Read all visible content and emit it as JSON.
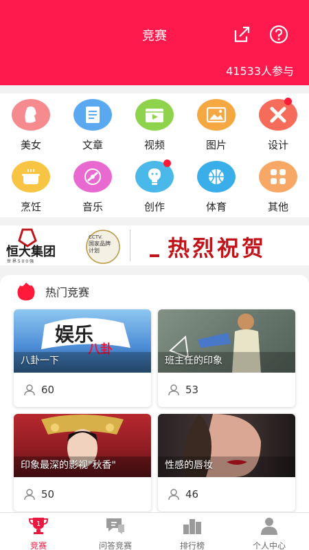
{
  "header": {
    "title": "竞赛",
    "participants": "41533人参与"
  },
  "categories": [
    {
      "label": "美女",
      "icon": "beauty-icon",
      "color": "#f58a8f"
    },
    {
      "label": "文章",
      "icon": "article-icon",
      "color": "#5aa8f0"
    },
    {
      "label": "视频",
      "icon": "video-icon",
      "color": "#8fd34c"
    },
    {
      "label": "图片",
      "icon": "picture-icon",
      "color": "#f5a742"
    },
    {
      "label": "设计",
      "icon": "design-icon",
      "color": "#f56c5a"
    },
    {
      "label": "烹饪",
      "icon": "cooking-icon",
      "color": "#f7c443"
    },
    {
      "label": "音乐",
      "icon": "music-icon",
      "color": "#e86ad0"
    },
    {
      "label": "创作",
      "icon": "creation-icon",
      "color": "#4ab8e8"
    },
    {
      "label": "体育",
      "icon": "sports-icon",
      "color": "#3aaee8"
    },
    {
      "label": "其他",
      "icon": "other-icon",
      "color": "#f7a766"
    }
  ],
  "banner": {
    "brand": "恒大集团",
    "brand_sub": "世 界 5 0 0 强",
    "cctv": "CCTV.",
    "cctv_line1": "国家品牌",
    "cctv_line2": "计划",
    "slogan": "热烈祝贺"
  },
  "hot": {
    "title": "热门竞赛",
    "cards": [
      {
        "caption": "八卦一下",
        "count": "60",
        "thumb_text_1": "娱乐",
        "thumb_text_2": "八卦"
      },
      {
        "caption": "班主任的印象",
        "count": "53"
      },
      {
        "caption": "印象最深的影视\"秋香\"",
        "count": "50"
      },
      {
        "caption": "性感的唇妆",
        "count": "46"
      }
    ]
  },
  "tabs": [
    {
      "label": "竞赛",
      "active": true
    },
    {
      "label": "问答竞赛",
      "active": false
    },
    {
      "label": "排行榜",
      "active": false
    },
    {
      "label": "个人中心",
      "active": false
    }
  ],
  "colors": {
    "accent": "#ff1a4e",
    "tab_active": "#e8183f"
  }
}
